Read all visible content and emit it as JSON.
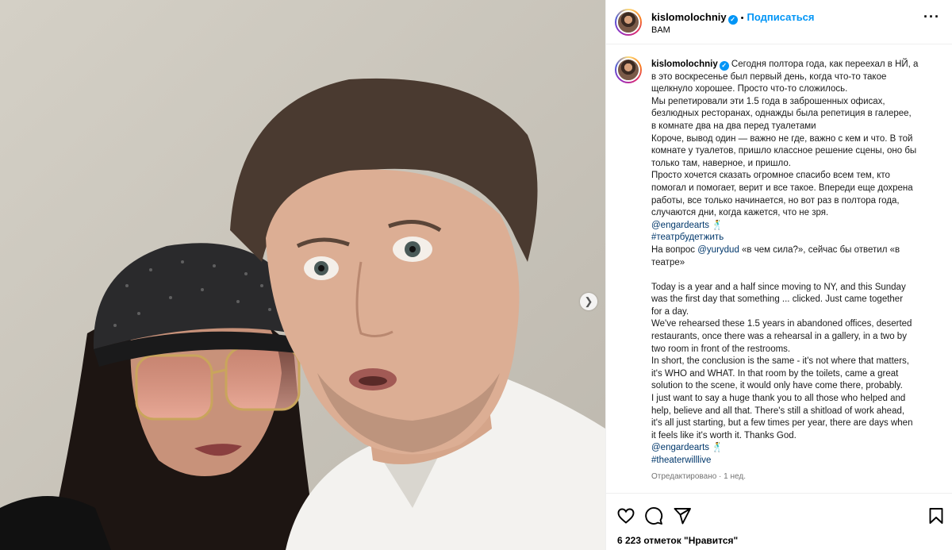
{
  "post": {
    "username": "kislomolochniy",
    "follow_label": "Подписаться",
    "audio_label": "BAM",
    "caption_lines": [
      "Сегодня полтора года, как переехал в НЙ, а",
      "в это воскресенье был первый день, когда что-то такое",
      "щелкнуло хорошее. Просто что-то сложилось.",
      "Мы репетировали эти 1.5 года в заброшенных офисах,",
      "безлюдных ресторанах, однажды была репетиция в галерее,",
      "в комнате два на два перед туалетами",
      "Короче, вывод один — важно не где, важно с кем и что. В той",
      "комнате у туалетов, пришло классное решение сцены, оно бы",
      "только там, наверное, и пришло.",
      "Просто хочется сказать огромное спасибо всем тем, кто",
      "помогал и помогает, верит и все такое. Впереди еще дохрена",
      "работы, все только начинается, но вот раз в полтора года,",
      "случаются дни, когда кажется, что не зря."
    ],
    "mention_1": "@engardearts 🕺",
    "hashtag_ru": "#театрбудетжить",
    "question_prefix": "На вопрос ",
    "question_mention": "@yurydud",
    "question_rest_1": " «в чем сила?», сейчас бы ответил «в",
    "question_rest_2": "театре»",
    "english_lines": [
      "Today is a year and a half since moving to NY, and this Sunday",
      "was the first day that something ... clicked. Just came together",
      "for a day.",
      "We've rehearsed these 1.5 years in abandoned offices, deserted",
      "restaurants, once there was a rehearsal in a gallery, in a two by",
      "two room in front of the restrooms.",
      "In short, the conclusion is the same - it's not where that matters,",
      "it's WHO and WHAT. In that room by the toilets, came a great",
      "solution to the scene, it would only have come there, probably.",
      "I just want to say a huge thank you to all those who helped and",
      "help, believe and all that. There's still a shitload of work ahead,",
      "it's all just starting, but a few times per year, there are days when",
      "it feels like it's worth it. Thanks God."
    ],
    "mention_2": "@engardearts 🕺",
    "hashtag_en": "#theaterwilllive",
    "edited_label": "Отредактировано",
    "edited_time": "1 нед.",
    "likes_text": "6 223 отметок \"Нравится\""
  },
  "icons": {
    "verified": "verified-badge-icon",
    "more": "more-options-icon",
    "like": "heart-icon",
    "comment": "comment-icon",
    "share": "share-icon",
    "save": "bookmark-icon",
    "next": "chevron-right-icon"
  }
}
